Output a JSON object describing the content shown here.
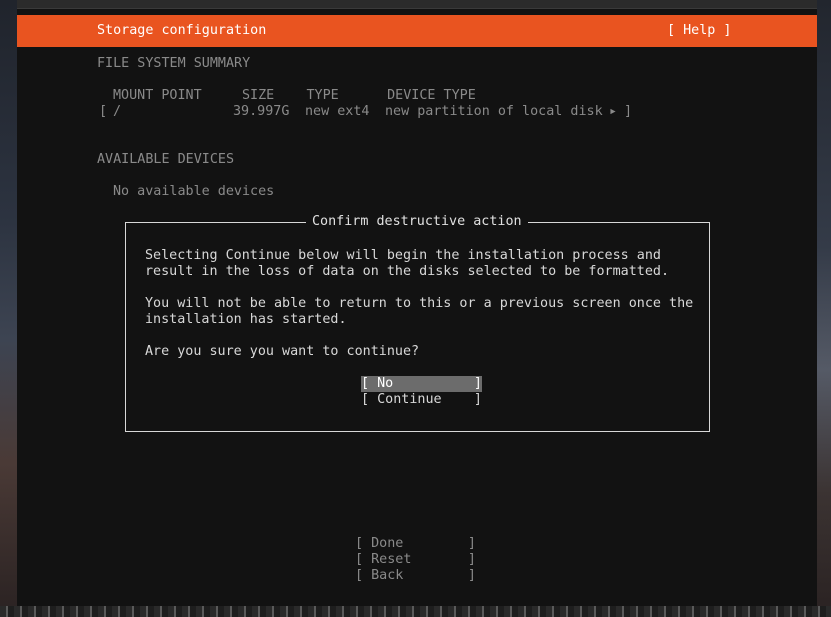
{
  "header": {
    "title": "Storage configuration",
    "help_label": "[ Help ]"
  },
  "fs_summary": {
    "heading": "FILE SYSTEM SUMMARY",
    "columns_line": "MOUNT POINT     SIZE    TYPE      DEVICE TYPE",
    "row": {
      "open": "[",
      "mount": "/",
      "size": "39.997G",
      "type": "new ext4",
      "device_type": "new partition of local disk",
      "arrow": "▸",
      "close": "]"
    }
  },
  "available": {
    "heading": "AVAILABLE DEVICES",
    "empty_text": "No available devices"
  },
  "dialog": {
    "title": "Confirm destructive action",
    "lines": [
      "Selecting Continue below will begin the installation process and",
      "result in the loss of data on the disks selected to be formatted.",
      "You will not be able to return to this or a previous screen once the",
      "installation has started.",
      "Are you sure you want to continue?"
    ],
    "buttons": {
      "no": "[ No          ]",
      "continue": "[ Continue    ]"
    }
  },
  "bottom_buttons": {
    "done": "[ Done        ]",
    "reset": "[ Reset       ]",
    "back": "[ Back        ]"
  }
}
